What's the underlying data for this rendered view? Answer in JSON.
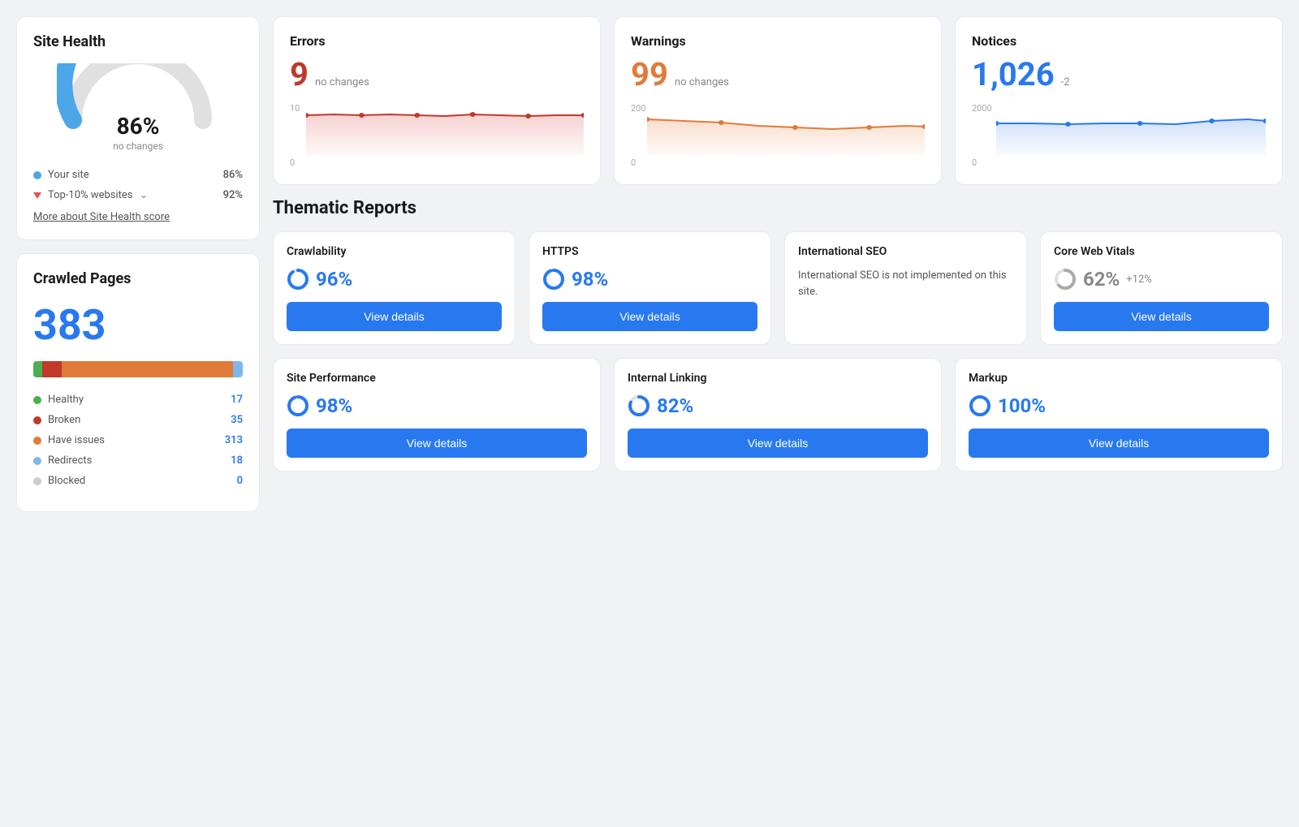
{
  "siteHealth": {
    "title": "Site Health",
    "percent": "86%",
    "subtext": "no changes",
    "yourSiteLabel": "Your site",
    "yourSiteValue": "86%",
    "topSitesLabel": "Top-10% websites",
    "topSitesValue": "92%",
    "moreLink": "More about Site Health score",
    "gaugeColor": "#4da6e8",
    "grayColor": "#c8c8c8"
  },
  "crawledPages": {
    "title": "Crawled Pages",
    "total": "383",
    "legend": [
      {
        "label": "Healthy",
        "value": "17",
        "color": "#4caf50"
      },
      {
        "label": "Broken",
        "value": "35",
        "color": "#c0392b"
      },
      {
        "label": "Have issues",
        "value": "313",
        "color": "#e07b39"
      },
      {
        "label": "Redirects",
        "value": "18",
        "color": "#7db8e8"
      },
      {
        "label": "Blocked",
        "value": "0",
        "color": "#ccc"
      }
    ],
    "barSegments": [
      {
        "pct": 4.4,
        "color": "#4caf50"
      },
      {
        "pct": 9.1,
        "color": "#c0392b"
      },
      {
        "pct": 81.7,
        "color": "#e07b39"
      },
      {
        "pct": 4.7,
        "color": "#7db8e8"
      }
    ]
  },
  "errors": {
    "title": "Errors",
    "number": "9",
    "change": "no changes",
    "chartTopLabel": "10",
    "chartBottomLabel": "0",
    "color": "#c0392b"
  },
  "warnings": {
    "title": "Warnings",
    "number": "99",
    "change": "no changes",
    "chartTopLabel": "200",
    "chartBottomLabel": "0",
    "color": "#e07b39"
  },
  "notices": {
    "title": "Notices",
    "number": "1,026",
    "change": "-2",
    "chartTopLabel": "2000",
    "chartBottomLabel": "0",
    "color": "#2879f0"
  },
  "thematic": {
    "title": "Thematic Reports",
    "row1": [
      {
        "name": "Crawlability",
        "score": "96%",
        "scoreType": "blue",
        "change": "",
        "desc": "",
        "btnLabel": "View details"
      },
      {
        "name": "HTTPS",
        "score": "98%",
        "scoreType": "blue",
        "change": "",
        "desc": "",
        "btnLabel": "View details"
      },
      {
        "name": "International SEO",
        "score": "",
        "scoreType": "none",
        "change": "",
        "desc": "International SEO is not implemented on this site.",
        "btnLabel": ""
      },
      {
        "name": "Core Web Vitals",
        "score": "62%",
        "scoreType": "gray",
        "change": "+12%",
        "desc": "",
        "btnLabel": "View details"
      }
    ],
    "row2": [
      {
        "name": "Site Performance",
        "score": "98%",
        "scoreType": "blue",
        "change": "",
        "desc": "",
        "btnLabel": "View details"
      },
      {
        "name": "Internal Linking",
        "score": "82%",
        "scoreType": "blue",
        "change": "",
        "desc": "",
        "btnLabel": "View details"
      },
      {
        "name": "Markup",
        "score": "100%",
        "scoreType": "blue",
        "change": "",
        "desc": "",
        "btnLabel": "View details"
      }
    ]
  }
}
